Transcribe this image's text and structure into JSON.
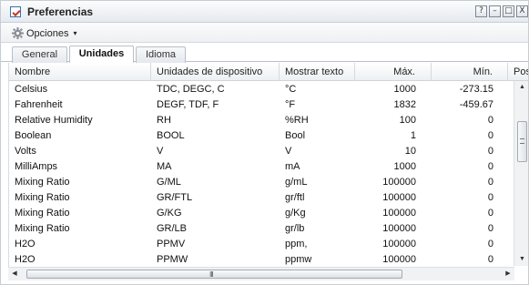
{
  "window": {
    "title": "Preferencias",
    "buttons": [
      "?",
      "–",
      "□",
      "X"
    ]
  },
  "toolbar": {
    "options_label": "Opciones",
    "options_icon": "gear-icon",
    "caret": "▾"
  },
  "tabs": [
    {
      "label": "General"
    },
    {
      "label": "Unidades",
      "active": true
    },
    {
      "label": "Idioma"
    }
  ],
  "table": {
    "columns": [
      "Nombre",
      "Unidades de dispositivo",
      "Mostrar texto",
      "Máx.",
      "Mín.",
      "Pos"
    ],
    "rows": [
      [
        "Celsius",
        "TDC, DEGC, C",
        "°C",
        "1000",
        "-273.15"
      ],
      [
        "Fahrenheit",
        "DEGF, TDF, F",
        "°F",
        "1832",
        "-459.67"
      ],
      [
        "Relative Humidity",
        "RH",
        "%RH",
        "100",
        "0"
      ],
      [
        "Boolean",
        "BOOL",
        "Bool",
        "1",
        "0"
      ],
      [
        "Volts",
        "V",
        "V",
        "10",
        "0"
      ],
      [
        "MilliAmps",
        "MA",
        "mA",
        "1000",
        "0"
      ],
      [
        "Mixing Ratio",
        "G/ML",
        "g/mL",
        "100000",
        "0"
      ],
      [
        "Mixing Ratio",
        "GR/FTL",
        "gr/ftl",
        "100000",
        "0"
      ],
      [
        "Mixing Ratio",
        "G/KG",
        "g/Kg",
        "100000",
        "0"
      ],
      [
        "Mixing Ratio",
        "GR/LB",
        "gr/lb",
        "100000",
        "0"
      ],
      [
        "H2O",
        "PPMV",
        "ppm,",
        "100000",
        "0"
      ],
      [
        "H2O",
        "PPMW",
        "ppmw",
        "100000",
        "0"
      ]
    ]
  },
  "scrollbars": {
    "hscroll_grip": "III",
    "up_arrow": "▲",
    "down_arrow": "▼",
    "left_arrow": "◀",
    "right_arrow": "▶",
    "vscroll_grip": "≡"
  }
}
